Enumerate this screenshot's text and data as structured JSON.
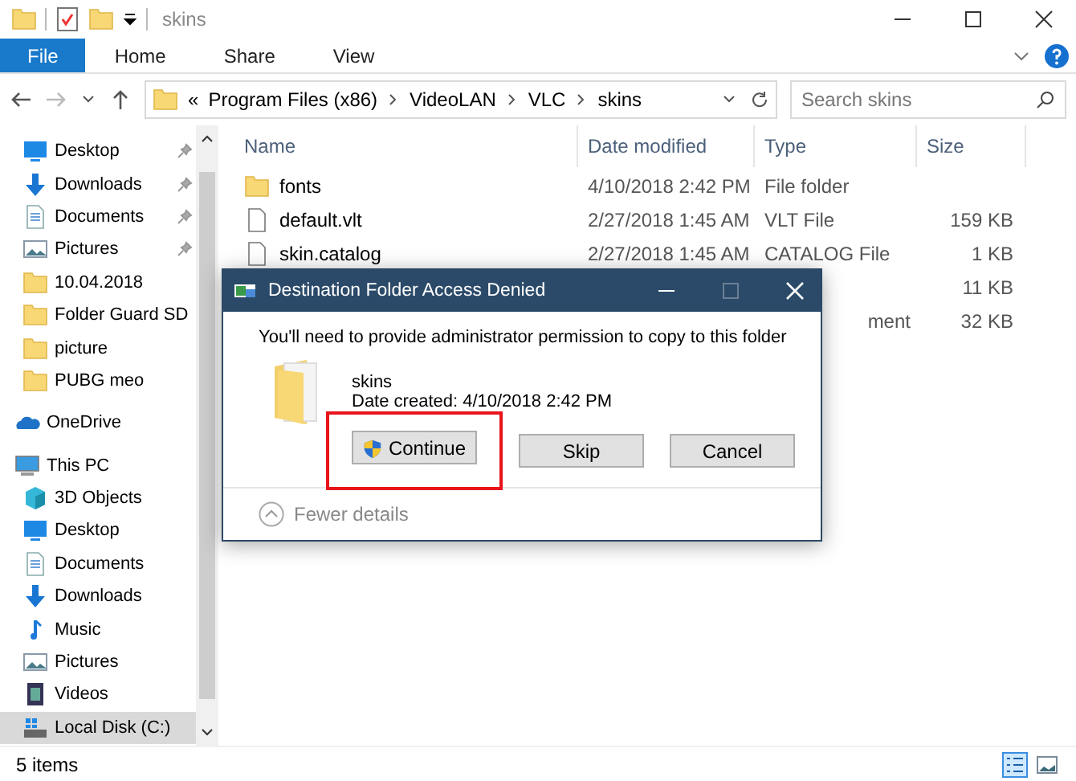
{
  "window": {
    "title": "skins"
  },
  "ribbon": {
    "tabs": [
      {
        "label": "File",
        "selected": true
      },
      {
        "label": "Home",
        "selected": false
      },
      {
        "label": "Share",
        "selected": false
      },
      {
        "label": "View",
        "selected": false
      }
    ]
  },
  "address": {
    "path": [
      {
        "label": "«"
      },
      {
        "label": "Program Files (x86)"
      },
      {
        "label": "VideoLAN"
      },
      {
        "label": "VLC"
      },
      {
        "label": "skins"
      }
    ],
    "search_placeholder": "Search skins"
  },
  "sidebar": {
    "quick_access": [
      {
        "label": "Desktop",
        "kind": "desktop",
        "pinned": true,
        "selected": false
      },
      {
        "label": "Downloads",
        "kind": "download",
        "pinned": true,
        "selected": false
      },
      {
        "label": "Documents",
        "kind": "document",
        "pinned": true,
        "selected": false
      },
      {
        "label": "Pictures",
        "kind": "pictures",
        "pinned": true,
        "selected": false
      },
      {
        "label": "10.04.2018",
        "kind": "folder",
        "pinned": false,
        "selected": false
      },
      {
        "label": "Folder Guard SD",
        "kind": "folder",
        "pinned": false,
        "selected": false
      },
      {
        "label": "picture",
        "kind": "folder",
        "pinned": false,
        "selected": false
      },
      {
        "label": "PUBG meo",
        "kind": "folder",
        "pinned": false,
        "selected": false
      }
    ],
    "locations": [
      {
        "label": "OneDrive",
        "kind": "cloud",
        "selected": false
      },
      {
        "label": "This PC",
        "kind": "pc",
        "selected": false,
        "children": [
          {
            "label": "3D Objects",
            "kind": "cube",
            "selected": false
          },
          {
            "label": "Desktop",
            "kind": "desktop",
            "selected": false
          },
          {
            "label": "Documents",
            "kind": "document",
            "selected": false
          },
          {
            "label": "Downloads",
            "kind": "download",
            "selected": false
          },
          {
            "label": "Music",
            "kind": "music",
            "selected": false
          },
          {
            "label": "Pictures",
            "kind": "pictures",
            "selected": false
          },
          {
            "label": "Videos",
            "kind": "video",
            "selected": false
          },
          {
            "label": "Local Disk (C:)",
            "kind": "disk",
            "selected": true
          }
        ]
      }
    ]
  },
  "table": {
    "columns": [
      "Name",
      "Date modified",
      "Type",
      "Size"
    ],
    "rows": [
      {
        "kind": "folder",
        "name": "fonts",
        "date": "4/10/2018 2:42 PM",
        "type": "File folder"
      },
      {
        "kind": "file",
        "name": "default.vlt",
        "date": "2/27/2018 1:45 AM",
        "type": "VLT File",
        "size": "159 KB"
      },
      {
        "kind": "file",
        "name": "skin.catalog",
        "date": "2/27/2018 1:45 AM",
        "type": "CATALOG File",
        "size": "1 KB"
      },
      {
        "kind": "covered",
        "size": "11 KB"
      },
      {
        "kind": "covered",
        "type": "ment",
        "size": "32 KB"
      }
    ]
  },
  "status_bar": {
    "count": "5 items"
  },
  "dialog": {
    "title": "Destination Folder Access Denied",
    "message": "You'll need to provide administrator permission to copy to this folder",
    "item_name": "skins",
    "item_date": "Date created: 4/10/2018 2:42 PM",
    "buttons": [
      {
        "label": "Continue",
        "kind": "shield",
        "highlighted": true
      },
      {
        "label": "Skip",
        "kind": "plain",
        "highlighted": false
      },
      {
        "label": "Cancel",
        "kind": "plain",
        "highlighted": false
      }
    ],
    "details_toggle": "Fewer details"
  }
}
